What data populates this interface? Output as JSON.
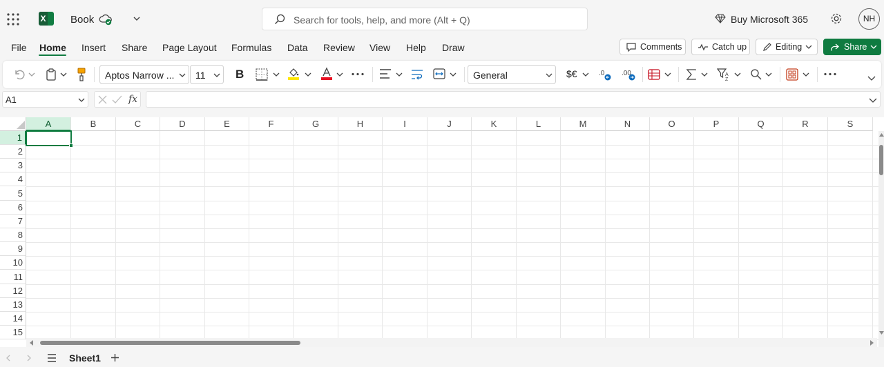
{
  "app": {
    "doc_title": "Book",
    "search_placeholder": "Search for tools, help, and more (Alt + Q)",
    "buy_label": "Buy Microsoft 365",
    "avatar_initials": "NH"
  },
  "menu": {
    "tabs": [
      "File",
      "Home",
      "Insert",
      "Share",
      "Page Layout",
      "Formulas",
      "Data",
      "Review",
      "View",
      "Help",
      "Draw"
    ],
    "active_tab": "Home",
    "comments_label": "Comments",
    "catchup_label": "Catch up",
    "editing_label": "Editing",
    "share_label": "Share"
  },
  "ribbon": {
    "font_name": "Aptos Narrow ...",
    "font_size": "11",
    "number_format": "General",
    "currency_glyph": "$€"
  },
  "formula_bar": {
    "name_box": "A1",
    "fx_label": "fx",
    "formula": ""
  },
  "grid": {
    "columns": [
      "A",
      "B",
      "C",
      "D",
      "E",
      "F",
      "G",
      "H",
      "I",
      "J",
      "K",
      "L",
      "M",
      "N",
      "O",
      "P",
      "Q",
      "R",
      "S"
    ],
    "rows": [
      "1",
      "2",
      "3",
      "4",
      "5",
      "6",
      "7",
      "8",
      "9",
      "10",
      "11",
      "12",
      "13",
      "14",
      "15"
    ],
    "active_cell": "A1"
  },
  "sheets": {
    "tabs": [
      "Sheet1"
    ],
    "active": "Sheet1"
  },
  "colors": {
    "accent": "#107c41",
    "share_bg": "#0f7b40",
    "fill_highlight": "#ffe600",
    "font_color": "#e81123"
  }
}
